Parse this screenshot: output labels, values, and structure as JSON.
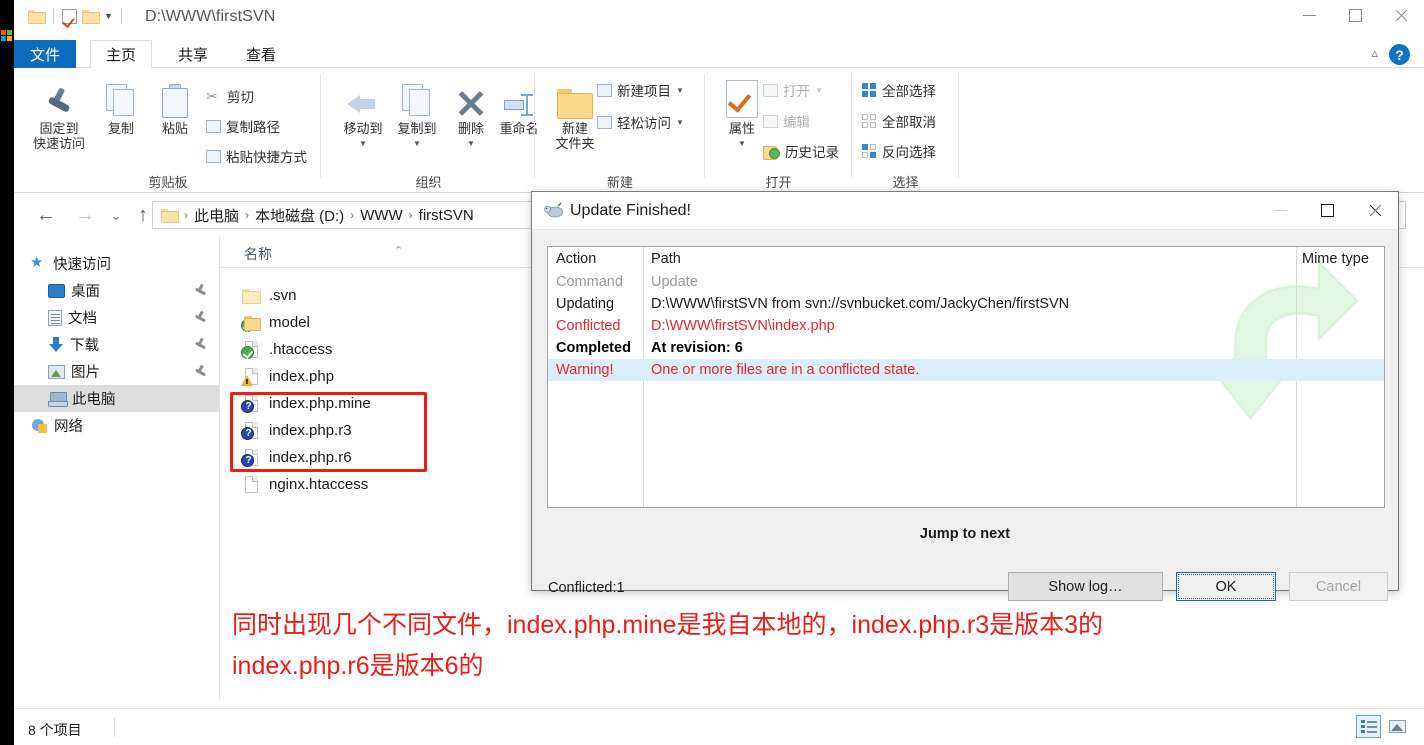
{
  "window": {
    "path_title": "D:\\WWW\\firstSVN",
    "minimize": "—",
    "maximize": "□",
    "close": "✕"
  },
  "ribbon_tabs": [
    {
      "label": "文件",
      "name": "tab-file"
    },
    {
      "label": "主页",
      "name": "tab-home"
    },
    {
      "label": "共享",
      "name": "tab-share"
    },
    {
      "label": "查看",
      "name": "tab-view"
    }
  ],
  "ribbon": {
    "clipboard": {
      "group_label": "剪贴板",
      "pin": "固定到\n快速访问",
      "pin_line1": "固定到",
      "pin_line2": "快速访问",
      "copy": "复制",
      "paste": "粘贴",
      "cut": "剪切",
      "copy_path": "复制路径",
      "paste_shortcut": "粘贴快捷方式"
    },
    "organize": {
      "group_label": "组织",
      "move_to": "移动到",
      "copy_to": "复制到",
      "delete": "删除",
      "rename": "重命名"
    },
    "new": {
      "group_label": "新建",
      "new_folder_line1": "新建",
      "new_folder_line2": "文件夹",
      "new_item": "新建项目",
      "easy_access": "轻松访问"
    },
    "open": {
      "group_label": "打开",
      "properties": "属性",
      "open": "打开",
      "edit": "编辑",
      "history": "历史记录"
    },
    "select": {
      "group_label": "选择",
      "select_all": "全部选择",
      "select_none": "全部取消",
      "invert": "反向选择"
    }
  },
  "nav": {
    "back": "←",
    "forward": "→",
    "recent": "⌄",
    "up": "↑",
    "breadcrumb": [
      "此电脑",
      "本地磁盘 (D:)",
      "WWW",
      "firstSVN"
    ],
    "sep": "›"
  },
  "columns": {
    "name": "名称",
    "sort_caret": "⌃"
  },
  "sidebar": {
    "items": [
      {
        "label": "快速访问",
        "icon": "star-icon",
        "pinned": false,
        "selected": false,
        "indent": 16
      },
      {
        "label": "桌面",
        "icon": "desktop-icon",
        "pinned": true,
        "selected": false,
        "indent": 34
      },
      {
        "label": "文档",
        "icon": "documents-icon",
        "pinned": true,
        "selected": false,
        "indent": 34
      },
      {
        "label": "下载",
        "icon": "download-icon",
        "pinned": true,
        "selected": false,
        "indent": 34
      },
      {
        "label": "图片",
        "icon": "pictures-icon",
        "pinned": true,
        "selected": false,
        "indent": 34
      },
      {
        "label": "此电脑",
        "icon": "this-pc-icon",
        "pinned": false,
        "selected": true,
        "indent": 34
      },
      {
        "label": "网络",
        "icon": "network-icon",
        "pinned": false,
        "selected": false,
        "indent": 16
      }
    ]
  },
  "files": [
    {
      "name": ".svn",
      "icon": "folder-icon",
      "overlay": "none",
      "highlighted": false
    },
    {
      "name": "model",
      "icon": "folder-icon",
      "overlay": "green",
      "highlighted": false
    },
    {
      "name": ".htaccess",
      "icon": "file-icon",
      "overlay": "green",
      "highlighted": false
    },
    {
      "name": "index.php",
      "icon": "file-icon",
      "overlay": "warning",
      "highlighted": false
    },
    {
      "name": "index.php.mine",
      "icon": "file-icon",
      "overlay": "question",
      "highlighted": true
    },
    {
      "name": "index.php.r3",
      "icon": "file-icon",
      "overlay": "question",
      "highlighted": true
    },
    {
      "name": "index.php.r6",
      "icon": "file-icon",
      "overlay": "question",
      "highlighted": true
    },
    {
      "name": "nginx.htaccess",
      "icon": "file-icon",
      "overlay": "none",
      "highlighted": false
    }
  ],
  "status": {
    "count": "8 个项目"
  },
  "dialog": {
    "title": "Update Finished!",
    "columns": {
      "action": "Action",
      "path": "Path",
      "mime": "Mime type"
    },
    "rows": [
      {
        "action": "Command",
        "path": "Update",
        "style": "muted",
        "highlighted": false
      },
      {
        "action": "Updating",
        "path": "D:\\WWW\\firstSVN from svn://svnbucket.com/JackyChen/firstSVN",
        "style": "normal",
        "highlighted": false
      },
      {
        "action": "Conflicted",
        "path": "D:\\WWW\\firstSVN\\index.php",
        "style": "conflict",
        "highlighted": false
      },
      {
        "action": "Completed",
        "path": "At revision: 6",
        "style": "completed",
        "highlighted": false
      },
      {
        "action": "Warning!",
        "path": "One or more files are in a conflicted state.",
        "style": "conflict",
        "highlighted": true
      }
    ],
    "jump_to_next": "Jump to next",
    "conflicted_count": "Conflicted:1",
    "buttons": {
      "show_log": "Show log…",
      "ok": "OK",
      "cancel": "Cancel"
    }
  },
  "annotation": {
    "line1": "同时出现几个不同文件，index.php.mine是我自本地的，index.php.r3是版本3的",
    "line2": "index.php.r6是版本6的"
  },
  "colors": {
    "accent": "#0f6cbd",
    "annotation_red": "#ec1c16",
    "conflict_red": "#e8262c",
    "highlight_blue": "#ddeefb",
    "redbox": "#f01c13"
  }
}
